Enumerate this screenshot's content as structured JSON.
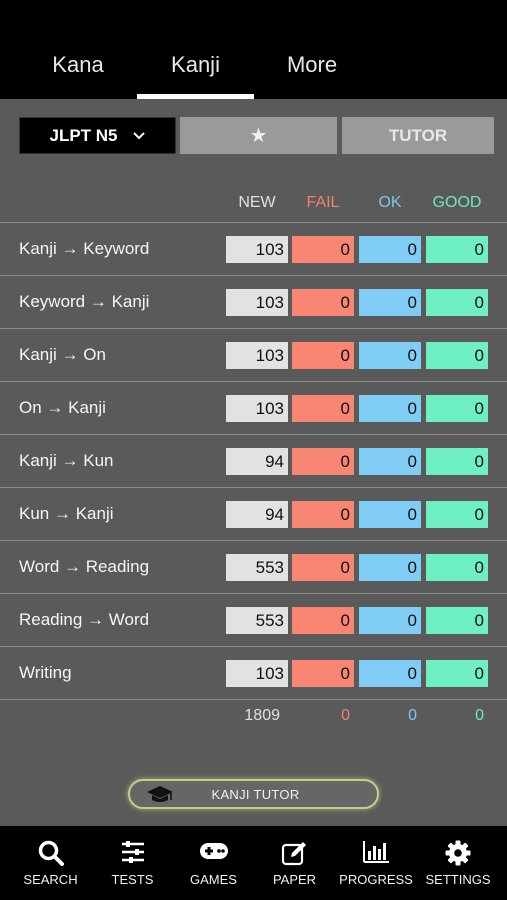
{
  "tabs": [
    "Kana",
    "Kanji",
    "More"
  ],
  "controls": {
    "level": "JLPT N5",
    "star": "★",
    "tutor": "TUTOR"
  },
  "columns": {
    "new": "NEW",
    "fail": "FAIL",
    "ok": "OK",
    "good": "GOOD"
  },
  "colors": {
    "new": "#e2e2e2",
    "fail": "#f98673",
    "ok": "#7fcdf5",
    "good": "#6ef0c2"
  },
  "rows": [
    {
      "label": "Kanji → Keyword",
      "new": "103",
      "fail": "0",
      "ok": "0",
      "good": "0"
    },
    {
      "label": "Keyword → Kanji",
      "new": "103",
      "fail": "0",
      "ok": "0",
      "good": "0"
    },
    {
      "label": "Kanji → On",
      "new": "103",
      "fail": "0",
      "ok": "0",
      "good": "0"
    },
    {
      "label": "On → Kanji",
      "new": "103",
      "fail": "0",
      "ok": "0",
      "good": "0"
    },
    {
      "label": "Kanji → Kun",
      "new": "94",
      "fail": "0",
      "ok": "0",
      "good": "0"
    },
    {
      "label": "Kun → Kanji",
      "new": "94",
      "fail": "0",
      "ok": "0",
      "good": "0"
    },
    {
      "label": "Word → Reading",
      "new": "553",
      "fail": "0",
      "ok": "0",
      "good": "0"
    },
    {
      "label": "Reading → Word",
      "new": "553",
      "fail": "0",
      "ok": "0",
      "good": "0"
    },
    {
      "label": "Writing",
      "new": "103",
      "fail": "0",
      "ok": "0",
      "good": "0"
    }
  ],
  "totals": {
    "new": "1809",
    "fail": "0",
    "ok": "0",
    "good": "0"
  },
  "tutor_button": {
    "label": "KANJI TUTOR",
    "icon": "graduation-cap-icon"
  },
  "tabbar": [
    {
      "label": "SEARCH",
      "icon": "search-icon"
    },
    {
      "label": "TESTS",
      "icon": "sliders-icon"
    },
    {
      "label": "GAMES",
      "icon": "gamepad-icon"
    },
    {
      "label": "PAPER",
      "icon": "pencil-square-icon"
    },
    {
      "label": "PROGRESS",
      "icon": "bar-chart-icon"
    },
    {
      "label": "SETTINGS",
      "icon": "gear-icon"
    }
  ]
}
